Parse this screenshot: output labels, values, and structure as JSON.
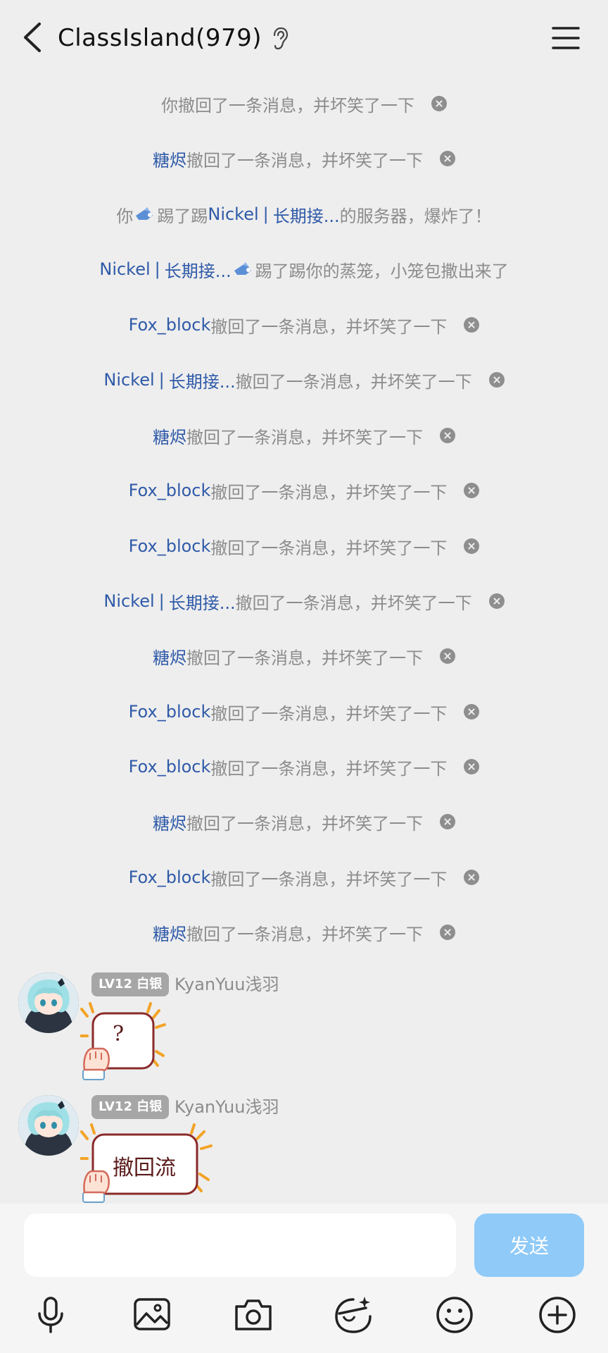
{
  "header": {
    "title": "ClassIsland(979)",
    "back_icon": "back-chevron-icon",
    "ear_icon": "ear-icon",
    "menu_icon": "menu-icon"
  },
  "notices": [
    {
      "prefix": "你",
      "name": "",
      "text": "撤回了一条消息，并坏笑了一下",
      "closable": true
    },
    {
      "prefix": "",
      "name": "糖烬",
      "text": "撤回了一条消息，并坏笑了一下",
      "closable": true
    },
    {
      "prefix": "你",
      "name": "",
      "text": "踢了踢",
      "target_a": "Nickel",
      "sep": "|",
      "target_b": "长期接...",
      "suffix": "的服务器，爆炸了！",
      "poke": true
    },
    {
      "prefix": "",
      "name": "Nickel",
      "sep": "|",
      "name_b": "长期接...",
      "text": "踢了踢你的蒸笼，小笼包撒出来了",
      "poke": true
    },
    {
      "prefix": "",
      "name": "Fox_block",
      "text": "撤回了一条消息，并坏笑了一下",
      "closable": true
    },
    {
      "prefix": "",
      "name": "Nickel",
      "sep": "|",
      "name_b": "长期接...",
      "text": "撤回了一条消息，并坏笑了一下",
      "closable": true
    },
    {
      "prefix": "",
      "name": "糖烬",
      "text": "撤回了一条消息，并坏笑了一下",
      "closable": true
    },
    {
      "prefix": "",
      "name": "Fox_block",
      "text": "撤回了一条消息，并坏笑了一下",
      "closable": true
    },
    {
      "prefix": "",
      "name": "Fox_block",
      "text": "撤回了一条消息，并坏笑了一下",
      "closable": true
    },
    {
      "prefix": "",
      "name": "Nickel",
      "sep": "|",
      "name_b": "长期接...",
      "text": "撤回了一条消息，并坏笑了一下",
      "closable": true
    },
    {
      "prefix": "",
      "name": "糖烬",
      "text": "撤回了一条消息，并坏笑了一下",
      "closable": true
    },
    {
      "prefix": "",
      "name": "Fox_block",
      "text": "撤回了一条消息，并坏笑了一下",
      "closable": true
    },
    {
      "prefix": "",
      "name": "Fox_block",
      "text": "撤回了一条消息，并坏笑了一下",
      "closable": true
    },
    {
      "prefix": "",
      "name": "糖烬",
      "text": "撤回了一条消息，并坏笑了一下",
      "closable": true
    },
    {
      "prefix": "",
      "name": "Fox_block",
      "text": "撤回了一条消息，并坏笑了一下",
      "closable": true
    },
    {
      "prefix": "",
      "name": "糖烬",
      "text": "撤回了一条消息，并坏笑了一下",
      "closable": true
    }
  ],
  "messages": [
    {
      "badge": "LV12 白银",
      "sender": "KyanYuu浅羽",
      "sticker_text": "?"
    },
    {
      "badge": "LV12 白银",
      "sender": "KyanYuu浅羽",
      "sticker_text": "撤回流"
    }
  ],
  "input": {
    "value": "",
    "send_label": "发送"
  },
  "toolbar": {
    "icons": [
      "microphone-icon",
      "image-icon",
      "camera-icon",
      "emoji-face-icon",
      "smiley-icon",
      "plus-circle-icon"
    ]
  },
  "colors": {
    "background": "#eeeeee",
    "name_link": "#2f5aa8",
    "notice_gray": "#8c8c8c",
    "send_button": "#8fcaf8",
    "badge": "#a6a6a6"
  }
}
